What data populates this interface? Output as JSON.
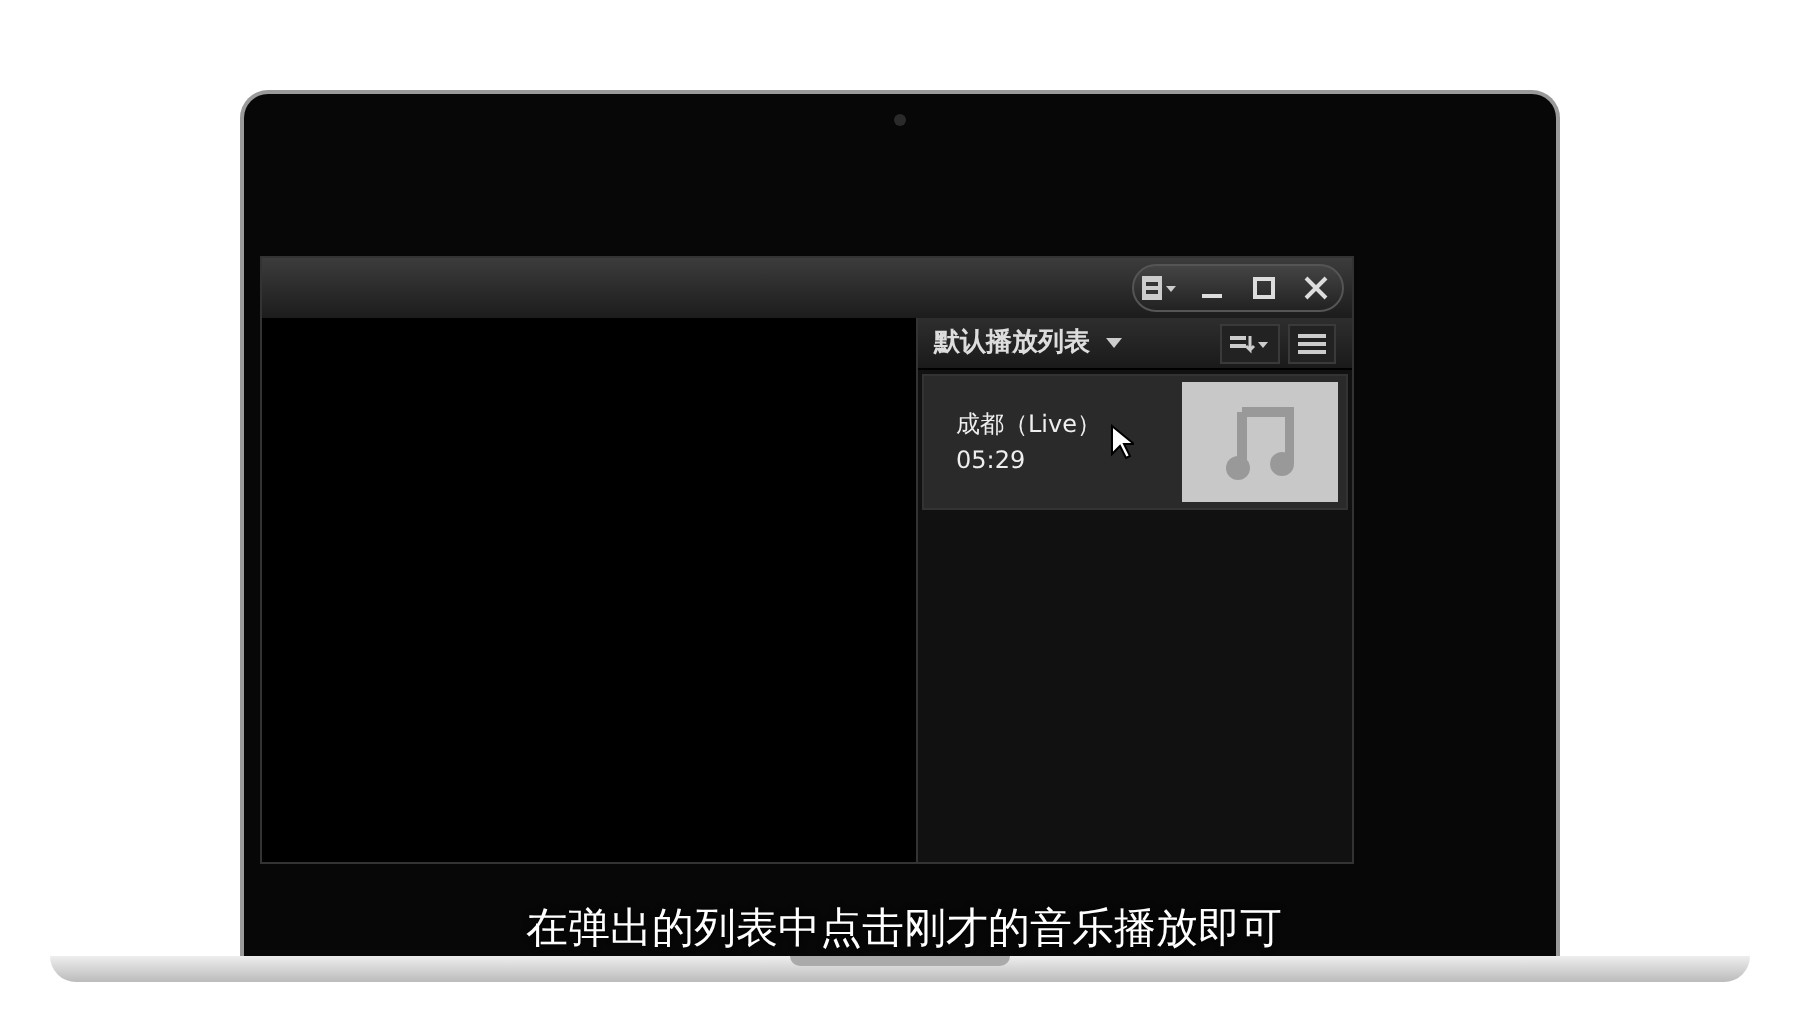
{
  "player": {
    "playlist_title": "默认播放列表",
    "tracks": [
      {
        "title": "成都（Live）",
        "duration": "05:29",
        "selected": true
      }
    ]
  },
  "subtitle": "在弹出的列表中点击刚才的音乐播放即可"
}
